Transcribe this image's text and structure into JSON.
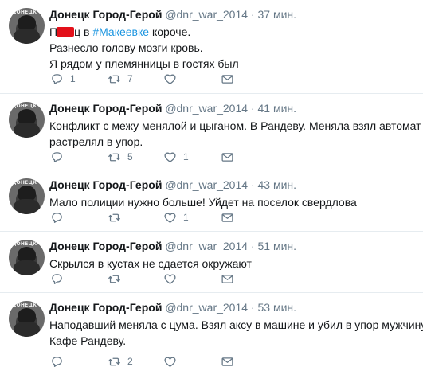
{
  "tweets": [
    {
      "name": "Донецк Город-Герой",
      "handle": "@dnr_war_2014",
      "dot": "·",
      "time": "37 мин.",
      "text": {
        "l1_pre": "П",
        "l1_post": "ц в ",
        "hashtag": "#Макеевке",
        "l1_end": " короче.",
        "l2": "Разнесло голову мозги кровь.",
        "l3": "Я рядом у племянницы в гостях был"
      },
      "replies": "1",
      "retweets": "7",
      "likes": ""
    },
    {
      "name": "Донецк Город-Герой",
      "handle": "@dnr_war_2014",
      "dot": "·",
      "time": "41 мин.",
      "text": {
        "l1": "Конфликт с межу менялой и цыганом. В Рандеву.  Меняла  взял автомат и",
        "l2": "растрелял в упор."
      },
      "replies": "",
      "retweets": "5",
      "likes": "1"
    },
    {
      "name": "Донецк Город-Герой",
      "handle": "@dnr_war_2014",
      "dot": "·",
      "time": "43 мин.",
      "text": {
        "l1": "Мало полиции нужно больше!  Уйдет на поселок свердлова"
      },
      "replies": "",
      "retweets": "",
      "likes": "1"
    },
    {
      "name": "Донецк Город-Герой",
      "handle": "@dnr_war_2014",
      "dot": "·",
      "time": "51 мин.",
      "text": {
        "l1": "Скрылся в кустах не сдается окружают"
      },
      "replies": "",
      "retweets": "",
      "likes": ""
    },
    {
      "name": "Донецк Город-Герой",
      "handle": "@dnr_war_2014",
      "dot": "·",
      "time": "53 мин.",
      "text": {
        "l1": "Наподавший меняла с цума.  Взял аксу в машине и убил в упор мужчину.",
        "l2": "Кафе Рандеву."
      },
      "replies": "",
      "retweets": "2",
      "likes": ""
    }
  ],
  "avatar_label": "ДОНЕЦК",
  "icons": {
    "reply": "reply-icon",
    "retweet": "retweet-icon",
    "like": "heart-icon",
    "dm": "envelope-icon"
  },
  "colors": {
    "hashtag": "#1b95e0",
    "muted": "#657786",
    "divider": "#e6ecf0"
  }
}
